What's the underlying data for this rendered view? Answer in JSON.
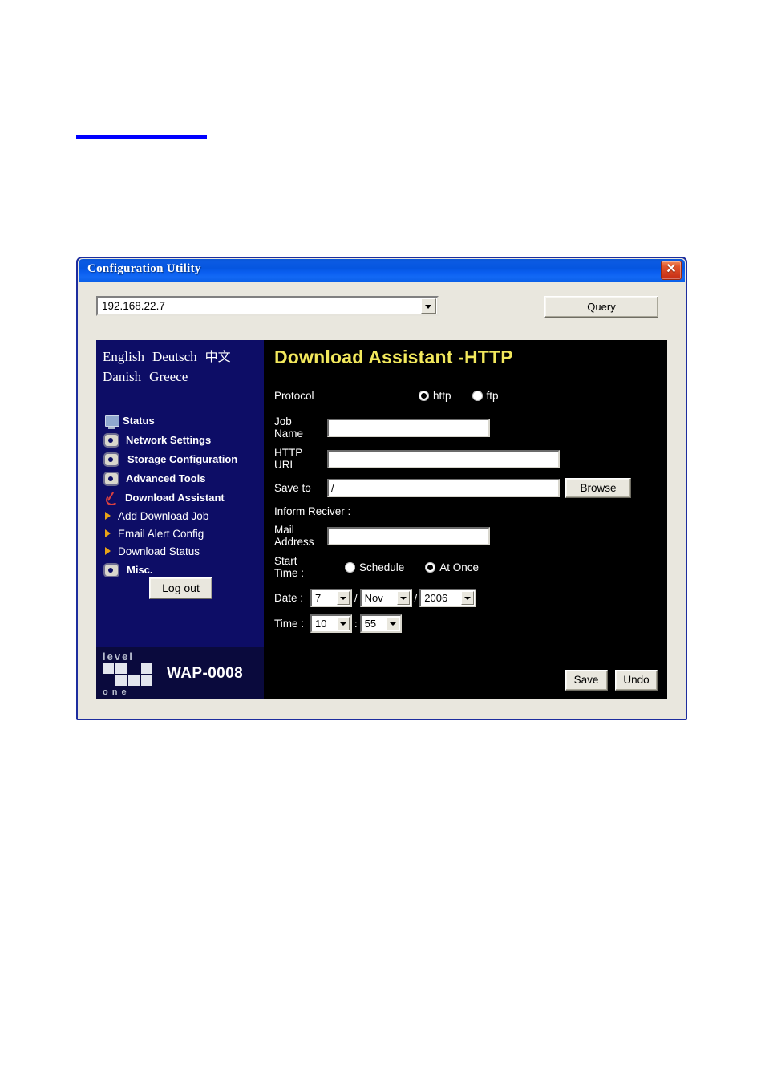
{
  "page": {
    "top_rule_color": "#0000ff"
  },
  "dialog": {
    "title": "Configuration Utility",
    "close_label": "✕",
    "address": {
      "value": "192.168.22.7",
      "placeholder": ""
    },
    "query_label": "Query"
  },
  "sidebar": {
    "languages": [
      {
        "label": "English"
      },
      {
        "label": "Deutsch"
      },
      {
        "label": "中文"
      },
      {
        "label": "Danish"
      },
      {
        "label": "Greece"
      }
    ],
    "items": [
      {
        "label": "Status",
        "icon": "monitor-icon"
      },
      {
        "label": "Network Settings",
        "icon": "gear-icon"
      },
      {
        "label": "Storage Configuration",
        "icon": "gear-icon"
      },
      {
        "label": "Advanced Tools",
        "icon": "gear-icon"
      },
      {
        "label": "Download Assistant",
        "icon": "check-pen-icon"
      }
    ],
    "subitems": [
      {
        "label": "Add Download Job",
        "icon": "arrow-right-icon"
      },
      {
        "label": "Email Alert Config",
        "icon": "arrow-right-icon"
      },
      {
        "label": "Download Status",
        "icon": "arrow-right-icon"
      }
    ],
    "misc": {
      "label": "Misc.",
      "icon": "gear-icon"
    },
    "logout_label": "Log out",
    "logo": {
      "brand_top": "level",
      "brand_bottom": "one",
      "model": "WAP-0008"
    }
  },
  "main": {
    "title": "Download Assistant -HTTP",
    "title_color": "#f2e85c",
    "protocol": {
      "label": "Protocol",
      "options": [
        {
          "label": "http",
          "selected": true
        },
        {
          "label": "ftp",
          "selected": false
        }
      ]
    },
    "job_name": {
      "label_line1": "Job",
      "label_line2": "Name",
      "value": ""
    },
    "http_url": {
      "label_line1": "HTTP",
      "label_line2": "URL",
      "value": ""
    },
    "save_to": {
      "label": "Save to",
      "value": "/",
      "browse_label": "Browse"
    },
    "inform_receiver": {
      "label": "Inform Reciver :"
    },
    "mail_address": {
      "label_line1": "Mail",
      "label_line2": "Address",
      "value": ""
    },
    "start_time": {
      "label_line1": "Start",
      "label_line2": "Time :",
      "options": [
        {
          "label": "Schedule",
          "selected": false
        },
        {
          "label": "At Once",
          "selected": true
        }
      ]
    },
    "date": {
      "label": "Date :",
      "day": "7",
      "month": "Nov",
      "year": "2006",
      "sep1": "/",
      "sep2": "/"
    },
    "time": {
      "label": "Time :",
      "hour": "10",
      "minute": "55",
      "sep": ":"
    },
    "save_label": "Save",
    "undo_label": "Undo"
  }
}
